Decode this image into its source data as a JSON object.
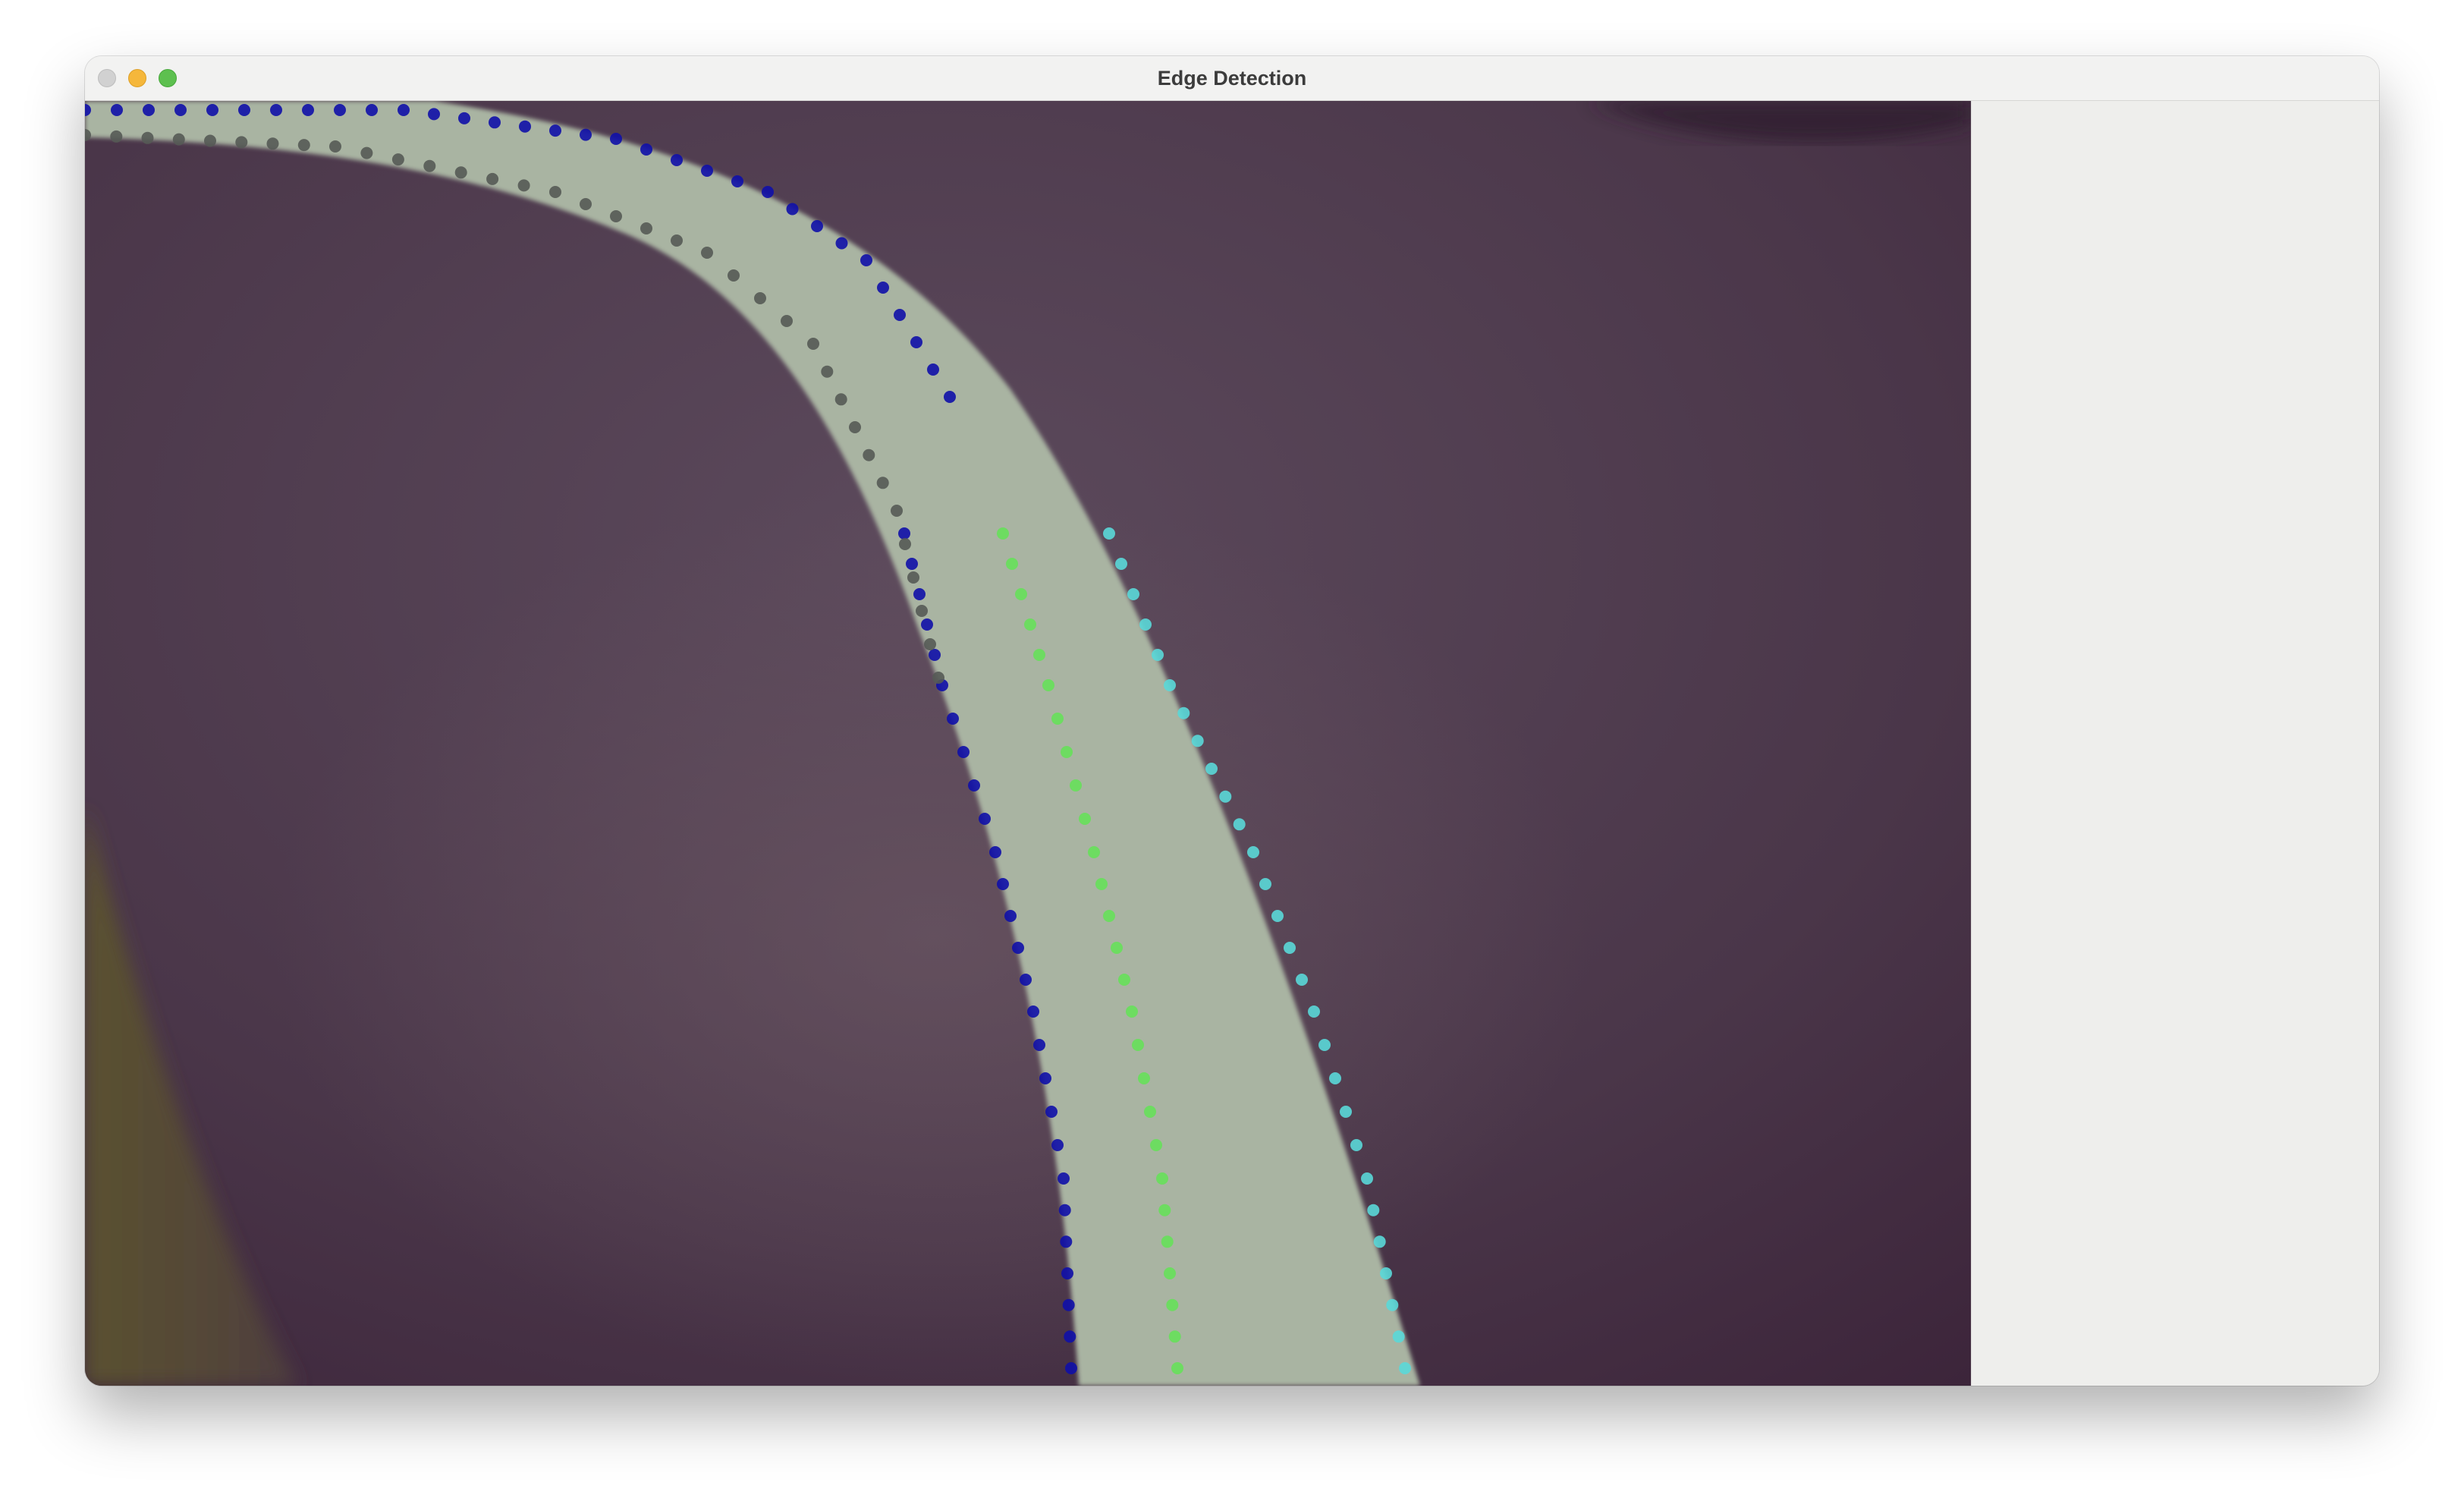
{
  "window": {
    "title": "Edge Detection"
  },
  "colors": {
    "left_edge_points": "#1010a8",
    "right_edge_points": "#5ad8d8",
    "center_points": "#66e05a",
    "upper_center_points": "#555a55",
    "track": "#a9b4a2",
    "background": "#4d3a4d"
  }
}
